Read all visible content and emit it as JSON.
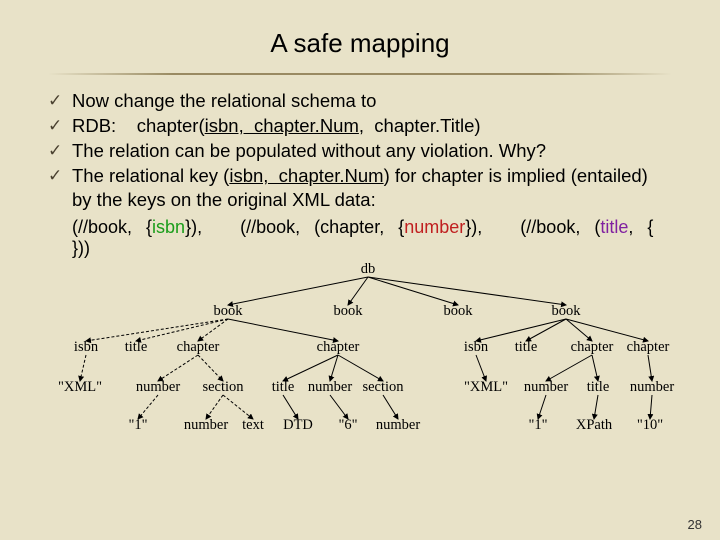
{
  "title": "A safe mapping",
  "bullets": {
    "b1": "Now change the relational schema to",
    "b2_pre": "RDB:    chapter(",
    "b2_k1": "isbn,  chapter.Num",
    "b2_mid": ",  chapter.Title)",
    "b3": "The relation can be populated without any violation. Why?",
    "b4_pre": "The relational key (",
    "b4_k": "isbn,  chapter.Num",
    "b4_post": ") for chapter is implied (entailed) by the keys on the original XML data:"
  },
  "keyline": {
    "k1a": "(//book,",
    "k1b": "{",
    "k1c": "isbn",
    "k1d": "}),",
    "k2a": "(//book,",
    "k2b": "(chapter,",
    "k2c": "{",
    "k2d": "number",
    "k2e": "}),",
    "k3a": "(//book,",
    "k3b": "(",
    "k3c": "title",
    "k3d": ",",
    "k3e": "{ }))"
  },
  "tree": {
    "db": "db",
    "book": "book",
    "isbn": "isbn",
    "title": "title",
    "chapter": "chapter",
    "number": "number",
    "section": "section",
    "text": "text",
    "xml": "\"XML\"",
    "dtd": "DTD",
    "xpath": "XPath",
    "v1": "\"1\"",
    "v6": "\"6\"",
    "v10": "\"10\""
  },
  "page": "28"
}
